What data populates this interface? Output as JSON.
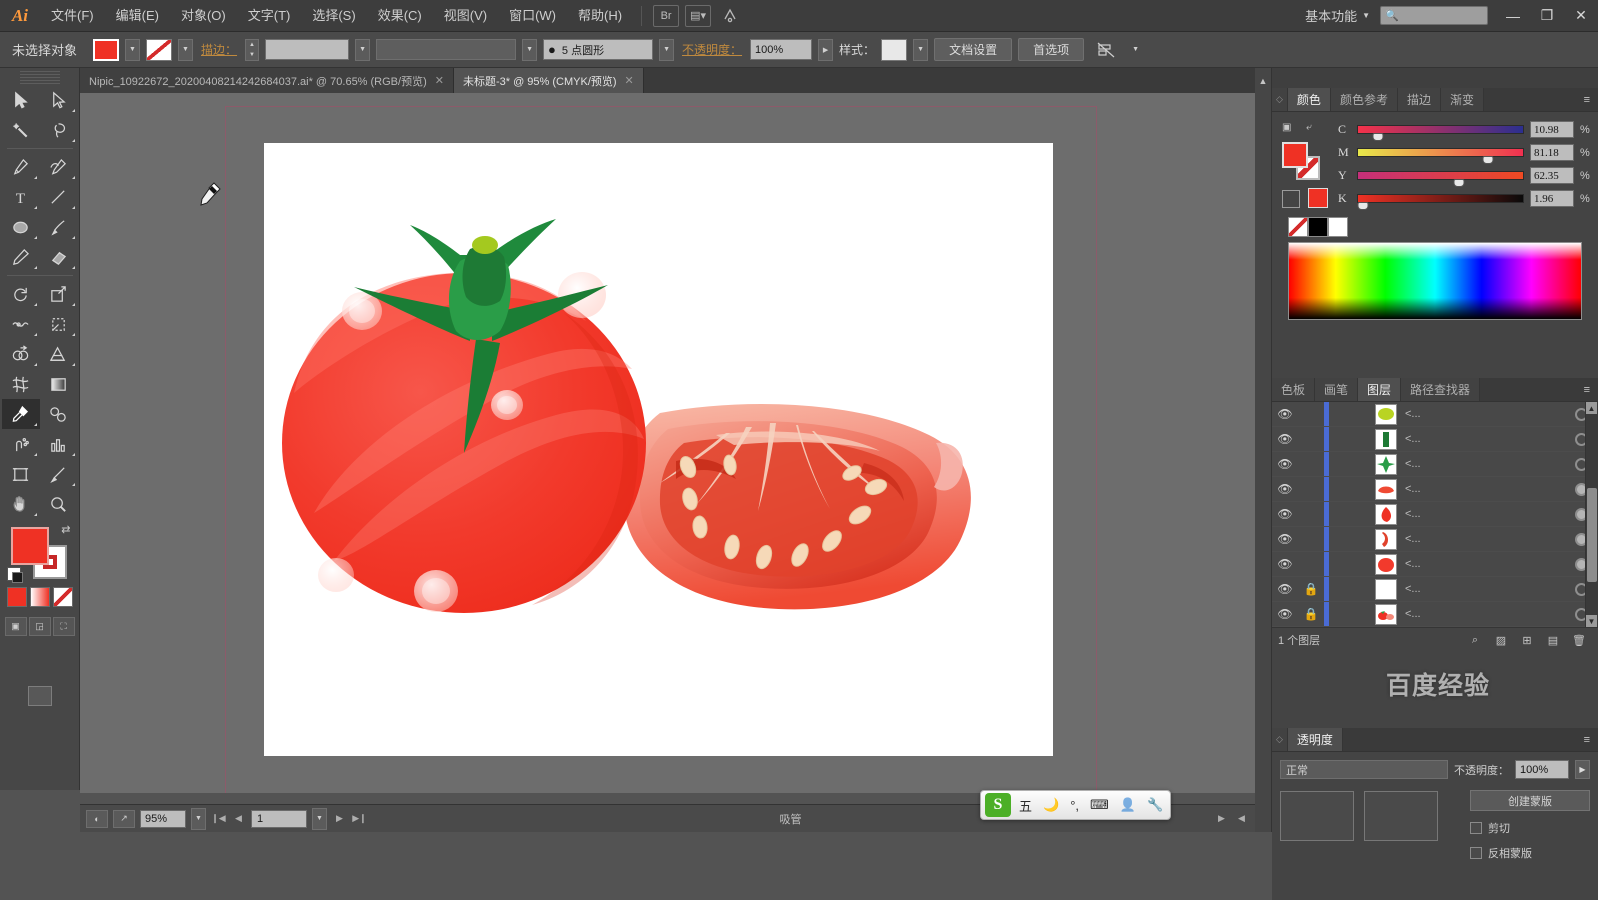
{
  "app": {
    "name": "Ai",
    "logo_color": "#ff9a3c"
  },
  "menubar": {
    "items": [
      {
        "label": "文件(F)",
        "name": "menu-file"
      },
      {
        "label": "编辑(E)",
        "name": "menu-edit"
      },
      {
        "label": "对象(O)",
        "name": "menu-object"
      },
      {
        "label": "文字(T)",
        "name": "menu-type"
      },
      {
        "label": "选择(S)",
        "name": "menu-select"
      },
      {
        "label": "效果(C)",
        "name": "menu-effect"
      },
      {
        "label": "视图(V)",
        "name": "menu-view"
      },
      {
        "label": "窗口(W)",
        "name": "menu-window"
      },
      {
        "label": "帮助(H)",
        "name": "menu-help"
      }
    ],
    "bridge_icon": "bridge-icon",
    "arrange_icon": "arrange-documents-icon",
    "stock_icon": "adobe-stock-icon",
    "workspace": "基本功能",
    "search_placeholder": "",
    "minimize": "—",
    "restore": "❐",
    "close": "✕"
  },
  "controlbar": {
    "selection_status": "未选择对象",
    "fill_color": "#ef3124",
    "stroke_label": "描边：",
    "stroke_weight": "",
    "stroke_profile": "",
    "brush_def": "5 点圆形",
    "opacity_label": "不透明度：",
    "opacity_value": "100%",
    "style_label": "样式：",
    "doc_setup": "文档设置",
    "preferences": "首选项",
    "align_icon": "align-icon"
  },
  "tabs": [
    {
      "title": "Nipic_10922672_20200408214242684037.ai* @ 70.65% (RGB/预览)",
      "active": false,
      "close": "✕"
    },
    {
      "title": "未标题-3* @ 95% (CMYK/预览)",
      "active": true,
      "close": "✕"
    }
  ],
  "toolbar": {
    "tools": [
      {
        "name": "selection-tool",
        "icon": "arrow-solid",
        "active": false
      },
      {
        "name": "direct-selection-tool",
        "icon": "arrow-outline",
        "active": false
      },
      {
        "name": "magic-wand-tool",
        "icon": "magic-wand",
        "active": false
      },
      {
        "name": "lasso-tool",
        "icon": "lasso",
        "active": false
      },
      {
        "name": "pen-tool",
        "icon": "pen",
        "active": false
      },
      {
        "name": "curvature-tool",
        "icon": "curvature",
        "active": false
      },
      {
        "name": "type-tool",
        "icon": "type-T",
        "active": false
      },
      {
        "name": "line-segment-tool",
        "icon": "line",
        "active": false
      },
      {
        "name": "ellipse-tool",
        "icon": "ellipse",
        "active": false
      },
      {
        "name": "paintbrush-tool",
        "icon": "paintbrush",
        "active": false
      },
      {
        "name": "pencil-tool",
        "icon": "pencil",
        "active": false
      },
      {
        "name": "eraser-tool",
        "icon": "eraser",
        "active": false
      },
      {
        "name": "rotate-tool",
        "icon": "rotate",
        "active": false
      },
      {
        "name": "scale-tool",
        "icon": "scale",
        "active": false
      },
      {
        "name": "width-tool",
        "icon": "width",
        "active": false
      },
      {
        "name": "free-transform-tool",
        "icon": "free-transform",
        "active": false
      },
      {
        "name": "shape-builder-tool",
        "icon": "shape-builder",
        "active": false
      },
      {
        "name": "perspective-grid-tool",
        "icon": "perspective-grid",
        "active": false
      },
      {
        "name": "mesh-tool",
        "icon": "mesh",
        "active": false
      },
      {
        "name": "gradient-tool",
        "icon": "gradient",
        "active": false
      },
      {
        "name": "eyedropper-tool",
        "icon": "eyedropper",
        "active": true
      },
      {
        "name": "blend-tool",
        "icon": "blend",
        "active": false
      },
      {
        "name": "symbol-sprayer-tool",
        "icon": "symbol-sprayer",
        "active": false
      },
      {
        "name": "column-graph-tool",
        "icon": "column-graph",
        "active": false
      },
      {
        "name": "artboard-tool",
        "icon": "artboard",
        "active": false
      },
      {
        "name": "slice-tool",
        "icon": "slice",
        "active": false
      },
      {
        "name": "hand-tool",
        "icon": "hand",
        "active": false
      },
      {
        "name": "zoom-tool",
        "icon": "magnifier",
        "active": false
      }
    ],
    "fill_color": "#ef3124",
    "stroke_color": "#ffffff",
    "swap_icon": "swap-fill-stroke-icon",
    "default_icon": "default-fill-stroke-icon",
    "color_modes": [
      "color-mode",
      "gradient-mode",
      "none-mode"
    ],
    "screen_modes": [
      "normal-screen-mode",
      "full-screen-menu-mode",
      "full-screen-mode"
    ]
  },
  "canvas": {
    "artwork_title": "番茄插画",
    "cursor": "eyedropper-cursor",
    "background": "#6d6d6d",
    "artboard_bg": "#ffffff"
  },
  "color_panel": {
    "tabs": [
      {
        "label": "颜色",
        "active": true
      },
      {
        "label": "颜色参考",
        "active": false
      },
      {
        "label": "描边",
        "active": false
      },
      {
        "label": "渐变",
        "active": false
      }
    ],
    "menu_icon": "panel-menu-icon",
    "mode": "CMYK",
    "channels": [
      {
        "label": "C",
        "value": "10.98",
        "pos": 12
      },
      {
        "label": "M",
        "value": "81.18",
        "pos": 79
      },
      {
        "label": "Y",
        "value": "62.35",
        "pos": 61
      },
      {
        "label": "K",
        "value": "1.96",
        "pos": 3
      }
    ],
    "percent_sign": "%",
    "fill_swatch": "#ef3124",
    "quick_swatches": [
      "none",
      "#000000",
      "#ffffff"
    ]
  },
  "layers_panel": {
    "tabs": [
      {
        "label": "色板",
        "active": false
      },
      {
        "label": "画笔",
        "active": false
      },
      {
        "label": "图层",
        "active": true
      },
      {
        "label": "路径查找器",
        "active": false
      }
    ],
    "menu_icon": "panel-menu-icon",
    "rows": [
      {
        "name": "<...",
        "visible": true,
        "locked": false,
        "thumb": "ellipse-green",
        "target_filled": false
      },
      {
        "name": "<...",
        "visible": true,
        "locked": false,
        "thumb": "stem-green",
        "target_filled": false
      },
      {
        "name": "<...",
        "visible": true,
        "locked": false,
        "thumb": "calyx-green",
        "target_filled": false
      },
      {
        "name": "<...",
        "visible": true,
        "locked": false,
        "thumb": "slice-red",
        "target_filled": true
      },
      {
        "name": "<...",
        "visible": true,
        "locked": false,
        "thumb": "wedge-red",
        "target_filled": true
      },
      {
        "name": "<...",
        "visible": true,
        "locked": false,
        "thumb": "half-red",
        "target_filled": true
      },
      {
        "name": "<...",
        "visible": true,
        "locked": false,
        "thumb": "circle-red",
        "target_filled": true
      },
      {
        "name": "<...",
        "visible": true,
        "locked": true,
        "thumb": "blank-white",
        "target_filled": false
      },
      {
        "name": "<...",
        "visible": true,
        "locked": true,
        "thumb": "tomatoes-full",
        "target_filled": false
      }
    ],
    "footer_count": "1 个图层",
    "footer_icons": [
      "locate-object-icon",
      "make-clipping-mask-icon",
      "create-sublayer-icon",
      "create-layer-icon",
      "delete-layer-icon"
    ],
    "eye_icon": "eye-icon",
    "lock_icon": "lock-icon"
  },
  "transparency_panel": {
    "tabs": [
      {
        "label": "透明度",
        "active": true
      }
    ],
    "menu_icon": "panel-menu-icon",
    "blend_mode": "正常",
    "opacity_label": "不透明度：",
    "opacity_value": "100%",
    "make_mask": "创建蒙版",
    "clip_label": "剪切",
    "invert_label": "反相蒙版"
  },
  "statusbar": {
    "zoom": "95%",
    "page": "1",
    "tool_status": "吸管",
    "first_icon": "preview-icon",
    "export_icon": "export-icon",
    "nav_first": "❙◀",
    "nav_prev": "◀",
    "nav_next": "▶",
    "nav_last": "▶❙"
  },
  "ime": {
    "logo": "S",
    "mode": "五",
    "moon_icon": "moon-icon",
    "punct_icon": "punctuation-icon",
    "keyboard_icon": "soft-keyboard-icon",
    "user_icon": "user-icon",
    "tools_icon": "wrench-icon"
  },
  "watermark": {
    "text": "百度经验"
  }
}
